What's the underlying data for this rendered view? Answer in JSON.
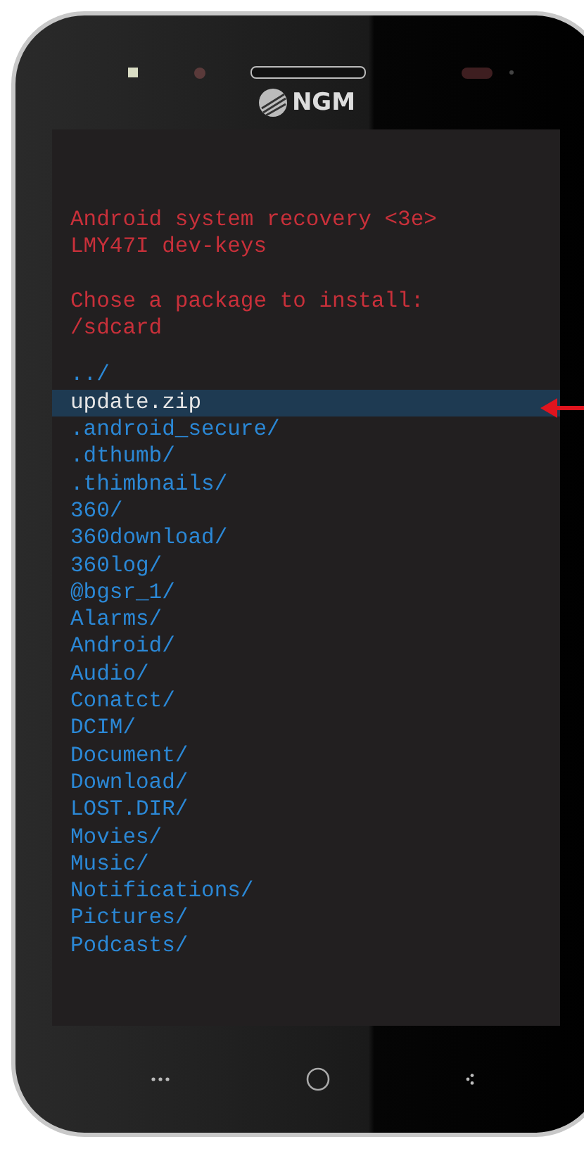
{
  "phone": {
    "brand": "NGM"
  },
  "recovery": {
    "header": [
      "Android system recovery <3e>",
      "LMY47I dev-keys"
    ],
    "prompt": [
      "Chose a package to install:",
      "/sdcard"
    ],
    "entries": [
      {
        "name": "../",
        "selected": false
      },
      {
        "name": "update.zip",
        "selected": true
      },
      {
        "name": ".android_secure/",
        "selected": false
      },
      {
        "name": ".dthumb/",
        "selected": false
      },
      {
        "name": ".thimbnails/",
        "selected": false
      },
      {
        "name": "360/",
        "selected": false
      },
      {
        "name": "360download/",
        "selected": false
      },
      {
        "name": "360log/",
        "selected": false
      },
      {
        "name": "@bgsr_1/",
        "selected": false
      },
      {
        "name": "Alarms/",
        "selected": false
      },
      {
        "name": "Android/",
        "selected": false
      },
      {
        "name": "Audio/",
        "selected": false
      },
      {
        "name": "Conatct/",
        "selected": false
      },
      {
        "name": "DCIM/",
        "selected": false
      },
      {
        "name": "Document/",
        "selected": false
      },
      {
        "name": "Download/",
        "selected": false
      },
      {
        "name": "LOST.DIR/",
        "selected": false
      },
      {
        "name": "Movies/",
        "selected": false
      },
      {
        "name": "Music/",
        "selected": false
      },
      {
        "name": "Notifications/",
        "selected": false
      },
      {
        "name": "Pictures/",
        "selected": false
      },
      {
        "name": "Podcasts/",
        "selected": false
      }
    ]
  }
}
